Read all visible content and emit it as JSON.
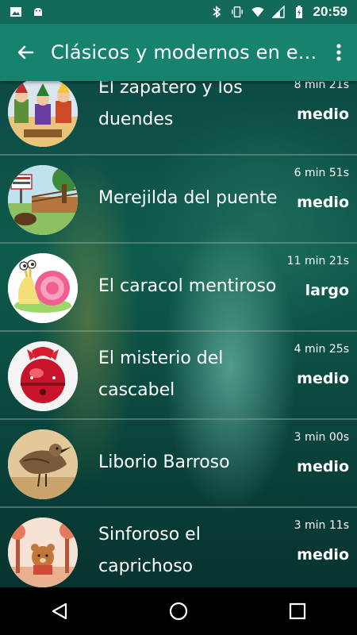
{
  "status_bar": {
    "time": "20:59",
    "left_icons": [
      "image-icon",
      "android-icon"
    ],
    "right_icons": [
      "bluetooth-icon",
      "vibrate-icon",
      "wifi-icon",
      "signal-icon",
      "battery-icon"
    ]
  },
  "app_bar": {
    "title": "Clásicos y modernos en e...",
    "back_icon": "arrow-back-icon",
    "menu_icon": "more-vert-icon",
    "color": "#17836f"
  },
  "stories": [
    {
      "title_line1": "El zapatero y los",
      "title_line2": "duendes",
      "duration": "8 min 21s",
      "level": "medio",
      "thumb": "elves-illustration"
    },
    {
      "title_line1": "Merejilda del puente",
      "title_line2": "",
      "duration": "6 min 51s",
      "level": "medio",
      "thumb": "park-bridge-illustration"
    },
    {
      "title_line1": "El caracol mentiroso",
      "title_line2": "",
      "duration": "11 min 21s",
      "level": "largo",
      "thumb": "snail-illustration"
    },
    {
      "title_line1": "El misterio del",
      "title_line2": "cascabel",
      "duration": "4 min 25s",
      "level": "medio",
      "thumb": "red-bell-photo"
    },
    {
      "title_line1": "Liborio Barroso",
      "title_line2": "",
      "duration": "3 min 00s",
      "level": "medio",
      "thumb": "bird-photo"
    },
    {
      "title_line1": "Sinforoso el",
      "title_line2": "caprichoso",
      "duration": "3 min 11s",
      "level": "medio",
      "thumb": "bear-forest-illustration"
    }
  ],
  "nav_bar": {
    "buttons": [
      "nav-back-icon",
      "nav-home-icon",
      "nav-recents-icon"
    ]
  }
}
